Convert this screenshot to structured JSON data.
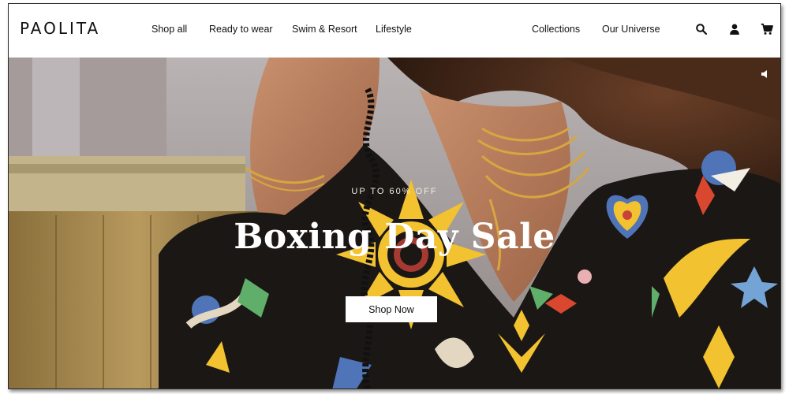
{
  "brand": {
    "logo": "PAOLITA"
  },
  "nav": {
    "items": [
      {
        "label": "Shop all"
      },
      {
        "label": "Ready to wear"
      },
      {
        "label": "Swim & Resort"
      },
      {
        "label": "Lifestyle"
      },
      {
        "label": "Collections"
      },
      {
        "label": "Our Universe"
      }
    ]
  },
  "header_icons": [
    "search-icon",
    "account-icon",
    "cart-icon"
  ],
  "hero": {
    "eyebrow": "UP TO 60% OFF",
    "headline": "Boxing Day Sale",
    "cta_label": "Shop Now",
    "sound_icon": "volume-icon"
  },
  "colors": {
    "text": "#111111",
    "hero_text": "#ffffff",
    "print_yellow": "#f2c230",
    "print_black": "#1b1714"
  }
}
